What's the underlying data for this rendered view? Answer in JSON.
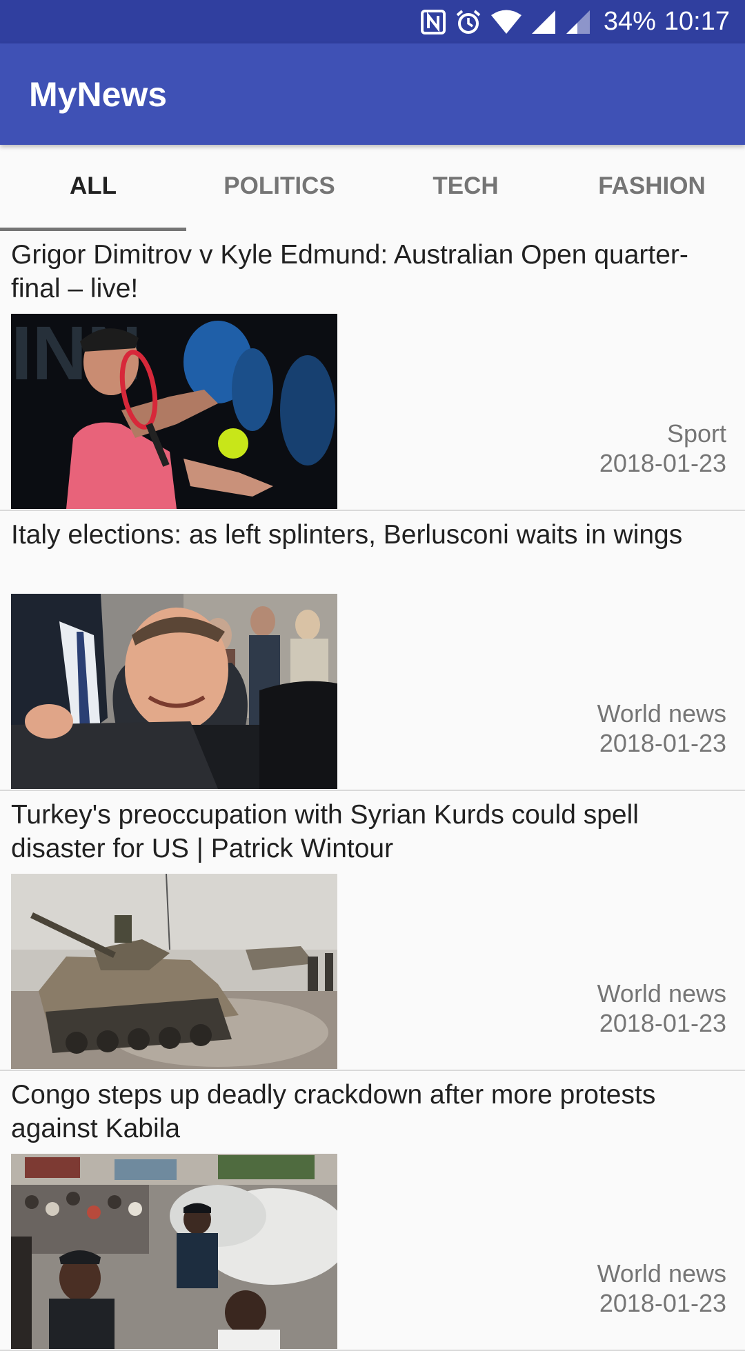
{
  "status_bar": {
    "battery": "34%",
    "time": "10:17",
    "icons": [
      "nfc-icon",
      "alarm-icon",
      "wifi-icon",
      "signal-icon",
      "signal-weak-icon"
    ]
  },
  "app_bar": {
    "title": "MyNews",
    "background": "#3f51b5",
    "status_background": "#303f9f"
  },
  "tabs": [
    {
      "label": "ALL",
      "active": true
    },
    {
      "label": "POLITICS",
      "active": false
    },
    {
      "label": "TECH",
      "active": false
    },
    {
      "label": "FASHION",
      "active": false
    }
  ],
  "articles": [
    {
      "title": "Grigor Dimitrov v Kyle Edmund: Australian Open quarter-final – live!",
      "section": "Sport",
      "date": "2018-01-23",
      "image": "tennis-player-photo"
    },
    {
      "title": "Italy elections: as left splinters, Berlusconi waits in wings",
      "section": "World news",
      "date": "2018-01-23",
      "image": "berlusconi-photo"
    },
    {
      "title": "Turkey's preoccupation with Syrian Kurds could spell disaster for US | Patrick Wintour",
      "section": "World news",
      "date": "2018-01-23",
      "image": "tank-photo"
    },
    {
      "title": "Congo steps up deadly crackdown after more protests against Kabila",
      "section": "World news",
      "date": "2018-01-23",
      "image": "protest-photo"
    }
  ]
}
